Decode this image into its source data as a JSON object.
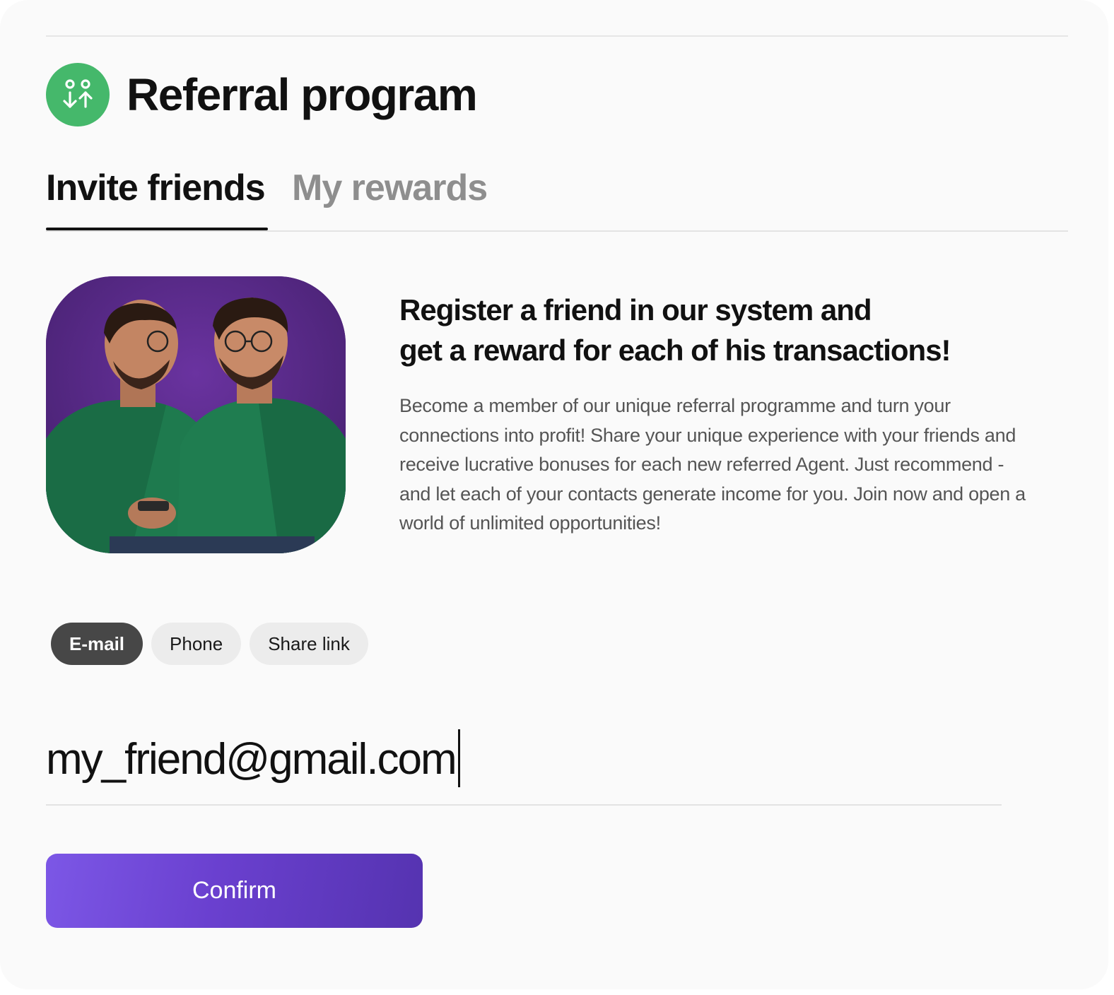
{
  "header": {
    "title": "Referral program",
    "logo_icon": "referral-people-icon",
    "logo_color": "#45b86b"
  },
  "tabs": [
    {
      "label": "Invite friends",
      "active": true
    },
    {
      "label": "My rewards",
      "active": false
    }
  ],
  "promo": {
    "image_alt": "two-friends-photo",
    "heading_line1": "Register a friend in our system and",
    "heading_line2": "get a reward for each of his transactions!",
    "body": "Become a member of our unique referral programme and turn your connections into profit! Share your unique experience with your friends and receive lucrative bonuses for each new referred Agent. Just recommend - and let each of your contacts generate income for you. Join now and open a world of unlimited opportunities!"
  },
  "methods": [
    {
      "label": "E-mail",
      "active": true
    },
    {
      "label": "Phone",
      "active": false
    },
    {
      "label": "Share link",
      "active": false
    }
  ],
  "email_input": {
    "value": "my_friend@gmail.com"
  },
  "confirm_button": {
    "label": "Confirm"
  },
  "colors": {
    "accent_gradient_start": "#7c57e6",
    "accent_gradient_end": "#5533b0",
    "active_chip": "#474747",
    "inactive_tab": "#8e8e8e"
  }
}
